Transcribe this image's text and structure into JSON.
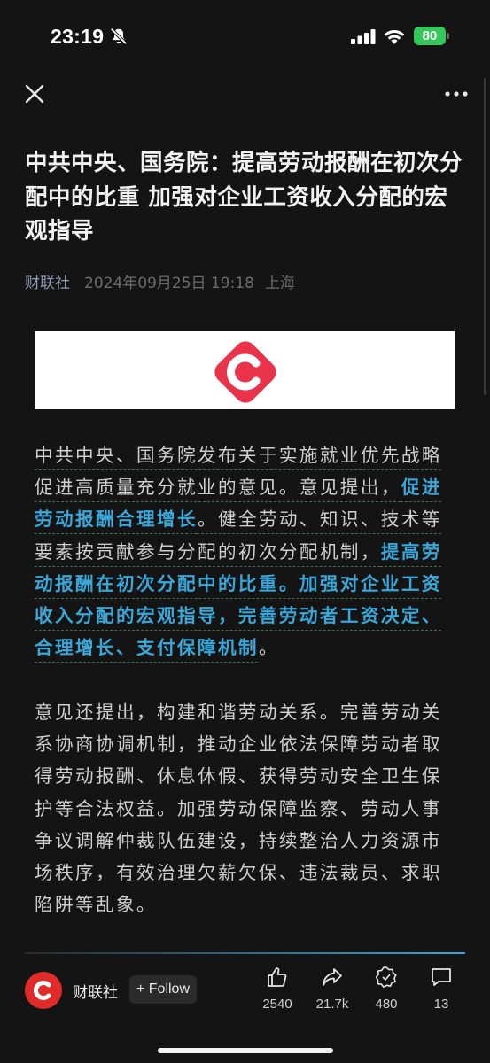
{
  "status_bar": {
    "time": "23:19",
    "battery": "80",
    "icons": [
      "bell-slash-icon",
      "signal-icon",
      "wifi-icon",
      "battery-icon"
    ]
  },
  "nav": {
    "close_icon": "close-icon",
    "more_icon": "more-icon"
  },
  "article": {
    "title": "中共中央、国务院：提高劳动报酬在初次分配中的比重 加强对企业工资收入分配的宏观指导",
    "source": "财联社",
    "date": "2024年09月25日 19:18",
    "location": "上海",
    "p1_a": "中共中央、国务院发布关于实施就业优先战略促进高质量充分就业的意见。意见提出，",
    "p1_link1": "促进劳动报酬合理增长",
    "p1_b": "。健全劳动、知识、技术等要素按贡献参与分配的初次分配机制，",
    "p1_link2": "提高劳动报酬在初次分配中的比重。加强对企业工资收入分配的宏观指导，完善劳动者工资决定、合理增长、支付保障机制",
    "p1_c": "。",
    "p2": "意见还提出，构建和谐劳动关系。完善劳动关系协商协调机制，推动企业依法保障劳动者取得劳动报酬、休息休假、获得劳动安全卫生保护等合法权益。加强劳动保障监察、劳动人事争议调解仲裁队伍建设，持续整治人力资源市场秩序，有效治理欠薪欠保、违法裁员、求职陷阱等乱象。"
  },
  "bottom_bar": {
    "source_name": "财联社",
    "follow_label": "+ Follow",
    "actions": [
      {
        "icon": "thumbs-up-icon",
        "count": "2540"
      },
      {
        "icon": "share-icon",
        "count": "21.7k"
      },
      {
        "icon": "badge-icon",
        "count": "480"
      },
      {
        "icon": "comment-icon",
        "count": "13"
      }
    ]
  },
  "colors": {
    "background": "#141414",
    "link": "#3aa7d8",
    "brand_red": "#e02b2b",
    "battery": "#34c759"
  }
}
